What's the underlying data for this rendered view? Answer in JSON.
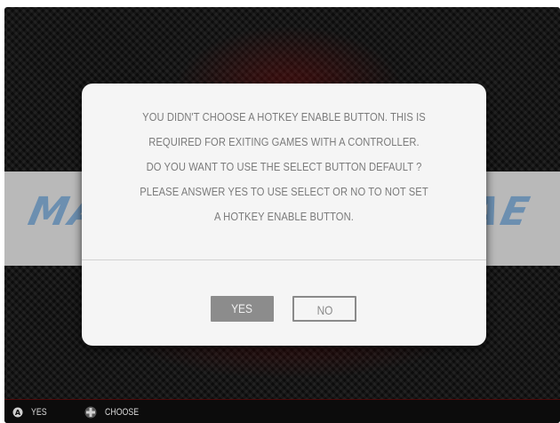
{
  "background": {
    "banner_logo_left": "MA",
    "banner_logo_right": "AE"
  },
  "dialog": {
    "message_lines": [
      "YOU DIDN'T CHOOSE A HOTKEY ENABLE BUTTON. THIS IS",
      "REQUIRED FOR EXITING GAMES WITH A CONTROLLER.",
      "DO YOU WANT TO USE THE SELECT BUTTON DEFAULT ?",
      "PLEASE ANSWER YES TO USE SELECT OR NO TO NOT SET",
      "A HOTKEY ENABLE BUTTON."
    ],
    "buttons": {
      "yes_label": "YES",
      "no_label": "NO",
      "selected": "YES"
    }
  },
  "help_bar": {
    "items": [
      {
        "icon": "a-button-icon",
        "label": "YES"
      },
      {
        "icon": "dpad-icon",
        "label": "CHOOSE"
      }
    ]
  },
  "colors": {
    "dialog_background": "#f5f5f5",
    "selected_button": "#8c8c8c",
    "banner": "#b9b9b9",
    "help_bar": "#0c0c0c"
  }
}
